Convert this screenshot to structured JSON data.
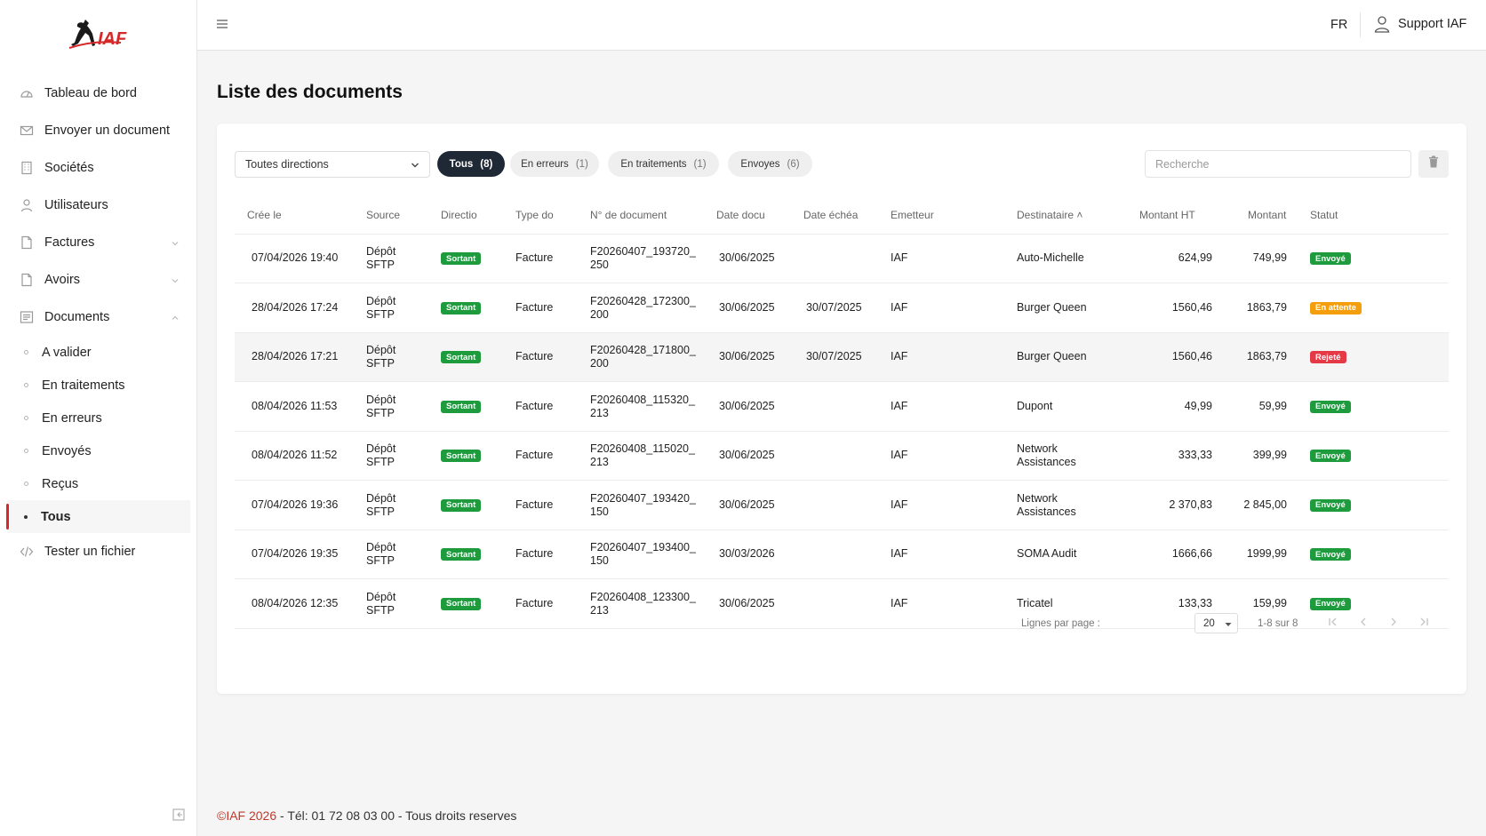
{
  "app": {
    "logo_text": "IAF"
  },
  "sidebar": {
    "items": [
      {
        "label": "Tableau de bord",
        "icon": "dashboard-icon"
      },
      {
        "label": "Envoyer un document",
        "icon": "mail-icon"
      },
      {
        "label": "Sociétés",
        "icon": "building-icon"
      },
      {
        "label": "Utilisateurs",
        "icon": "user-icon"
      },
      {
        "label": "Factures",
        "icon": "file-icon"
      },
      {
        "label": "Avoirs",
        "icon": "file-icon"
      },
      {
        "label": "Documents",
        "icon": "documents-icon"
      }
    ],
    "documents_sub": [
      {
        "label": "A valider"
      },
      {
        "label": "En traitements"
      },
      {
        "label": "En erreurs"
      },
      {
        "label": "Envoyés"
      },
      {
        "label": "Reçus"
      },
      {
        "label": "Tous"
      }
    ],
    "test_item": {
      "label": "Tester un fichier",
      "icon": "code-icon"
    }
  },
  "topbar": {
    "lang": "FR",
    "user": "Support IAF"
  },
  "page": {
    "title": "Liste des documents"
  },
  "filters": {
    "direction": "Toutes directions",
    "tabs": [
      {
        "label": "Tous",
        "count": "(8)"
      },
      {
        "label": "En erreurs",
        "count": "(1)"
      },
      {
        "label": "En traitements",
        "count": "(1)"
      },
      {
        "label": "Envoyes",
        "count": "(6)"
      }
    ],
    "search_placeholder": "Recherche"
  },
  "table": {
    "headers": [
      "Crée le",
      "Source",
      "Directio",
      "Type do",
      "N° de document",
      "Date docu",
      "Date échéa",
      "Emetteur",
      "Destinataire ˄",
      "Montant HT",
      "Montant",
      "Statut"
    ],
    "rows": [
      {
        "created": "07/04/2026 19:40",
        "source1": "Dépôt",
        "source2": "SFTP",
        "direction": "Sortant",
        "type": "Facture",
        "doc1": "F20260407_193720_",
        "doc2": "250",
        "date_doc": "30/06/2025",
        "date_due": "",
        "issuer": "IAF",
        "dest1": "Auto-Michelle",
        "dest2": "",
        "ht": "624,99",
        "ttc": "749,99",
        "status": "Envoyé",
        "status_color": "#1e9b3d"
      },
      {
        "created": "28/04/2026 17:24",
        "source1": "Dépôt",
        "source2": "SFTP",
        "direction": "Sortant",
        "type": "Facture",
        "doc1": "F20260428_172300_",
        "doc2": "200",
        "date_doc": "30/06/2025",
        "date_due": "30/07/2025",
        "issuer": "IAF",
        "dest1": "Burger Queen",
        "dest2": "",
        "ht": "1560,46",
        "ttc": "1863,79",
        "status": "En attente",
        "status_color": "#f59e0b"
      },
      {
        "created": "28/04/2026 17:21",
        "source1": "Dépôt",
        "source2": "SFTP",
        "direction": "Sortant",
        "type": "Facture",
        "doc1": "F20260428_171800_",
        "doc2": "200",
        "date_doc": "30/06/2025",
        "date_due": "30/07/2025",
        "issuer": "IAF",
        "dest1": "Burger Queen",
        "dest2": "",
        "ht": "1560,46",
        "ttc": "1863,79",
        "status": "Rejeté",
        "status_color": "#e53946"
      },
      {
        "created": "08/04/2026 11:53",
        "source1": "Dépôt",
        "source2": "SFTP",
        "direction": "Sortant",
        "type": "Facture",
        "doc1": "F20260408_115320_",
        "doc2": "213",
        "date_doc": "30/06/2025",
        "date_due": "",
        "issuer": "IAF",
        "dest1": "Dupont",
        "dest2": "",
        "ht": "49,99",
        "ttc": "59,99",
        "status": "Envoyé",
        "status_color": "#1e9b3d"
      },
      {
        "created": "08/04/2026 11:52",
        "source1": "Dépôt",
        "source2": "SFTP",
        "direction": "Sortant",
        "type": "Facture",
        "doc1": "F20260408_115020_",
        "doc2": "213",
        "date_doc": "30/06/2025",
        "date_due": "",
        "issuer": "IAF",
        "dest1": "Network",
        "dest2": "Assistances",
        "ht": "333,33",
        "ttc": "399,99",
        "status": "Envoyé",
        "status_color": "#1e9b3d"
      },
      {
        "created": "07/04/2026 19:36",
        "source1": "Dépôt",
        "source2": "SFTP",
        "direction": "Sortant",
        "type": "Facture",
        "doc1": "F20260407_193420_",
        "doc2": "150",
        "date_doc": "30/06/2025",
        "date_due": "",
        "issuer": "IAF",
        "dest1": "Network",
        "dest2": "Assistances",
        "ht": "2 370,83",
        "ttc": "2 845,00",
        "status": "Envoyé",
        "status_color": "#1e9b3d"
      },
      {
        "created": "07/04/2026 19:35",
        "source1": "Dépôt",
        "source2": "SFTP",
        "direction": "Sortant",
        "type": "Facture",
        "doc1": "F20260407_193400_",
        "doc2": "150",
        "date_doc": "30/03/2026",
        "date_due": "",
        "issuer": "IAF",
        "dest1": "SOMA Audit",
        "dest2": "",
        "ht": "1666,66",
        "ttc": "1999,99",
        "status": "Envoyé",
        "status_color": "#1e9b3d"
      },
      {
        "created": "08/04/2026 12:35",
        "source1": "Dépôt",
        "source2": "SFTP",
        "direction": "Sortant",
        "type": "Facture",
        "doc1": "F20260408_123300_",
        "doc2": "213",
        "date_doc": "30/06/2025",
        "date_due": "",
        "issuer": "IAF",
        "dest1": "Tricatel",
        "dest2": "",
        "ht": "133,33",
        "ttc": "159,99",
        "status": "Envoyé",
        "status_color": "#1e9b3d"
      }
    ]
  },
  "pagination": {
    "rows_label": "Lignes par page :",
    "rows_value": "20",
    "range": "1-8 sur 8"
  },
  "footer": {
    "brand": "©IAF 2026",
    "rest": " - Tél: 01 72 08 03 00 - Tous droits reserves"
  },
  "colors": {
    "accent": "#d62828",
    "active_pill": "#1f2935",
    "sent": "#1e9b3d",
    "pending": "#f59e0b",
    "rejected": "#e53946"
  }
}
